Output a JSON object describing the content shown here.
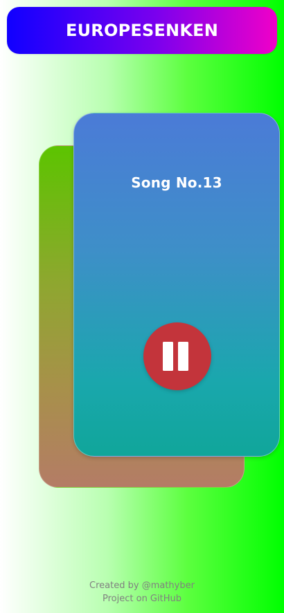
{
  "header": {
    "title": "EUROPESENKEN"
  },
  "player": {
    "song_title": "Song No.13",
    "state": "playing",
    "pause_icon": "pause-icon"
  },
  "footer": {
    "created_by": "Created by @mathyber",
    "github_link": "Project on GitHub"
  },
  "colors": {
    "header_gradient_start": "#1000ff",
    "header_gradient_end": "#f000c8",
    "pause_button": "#c3343b",
    "front_card_top": "#4b7bd7",
    "front_card_bottom": "#10a69a",
    "back_card_top": "#5cc400",
    "back_card_bottom": "#b47c66"
  }
}
